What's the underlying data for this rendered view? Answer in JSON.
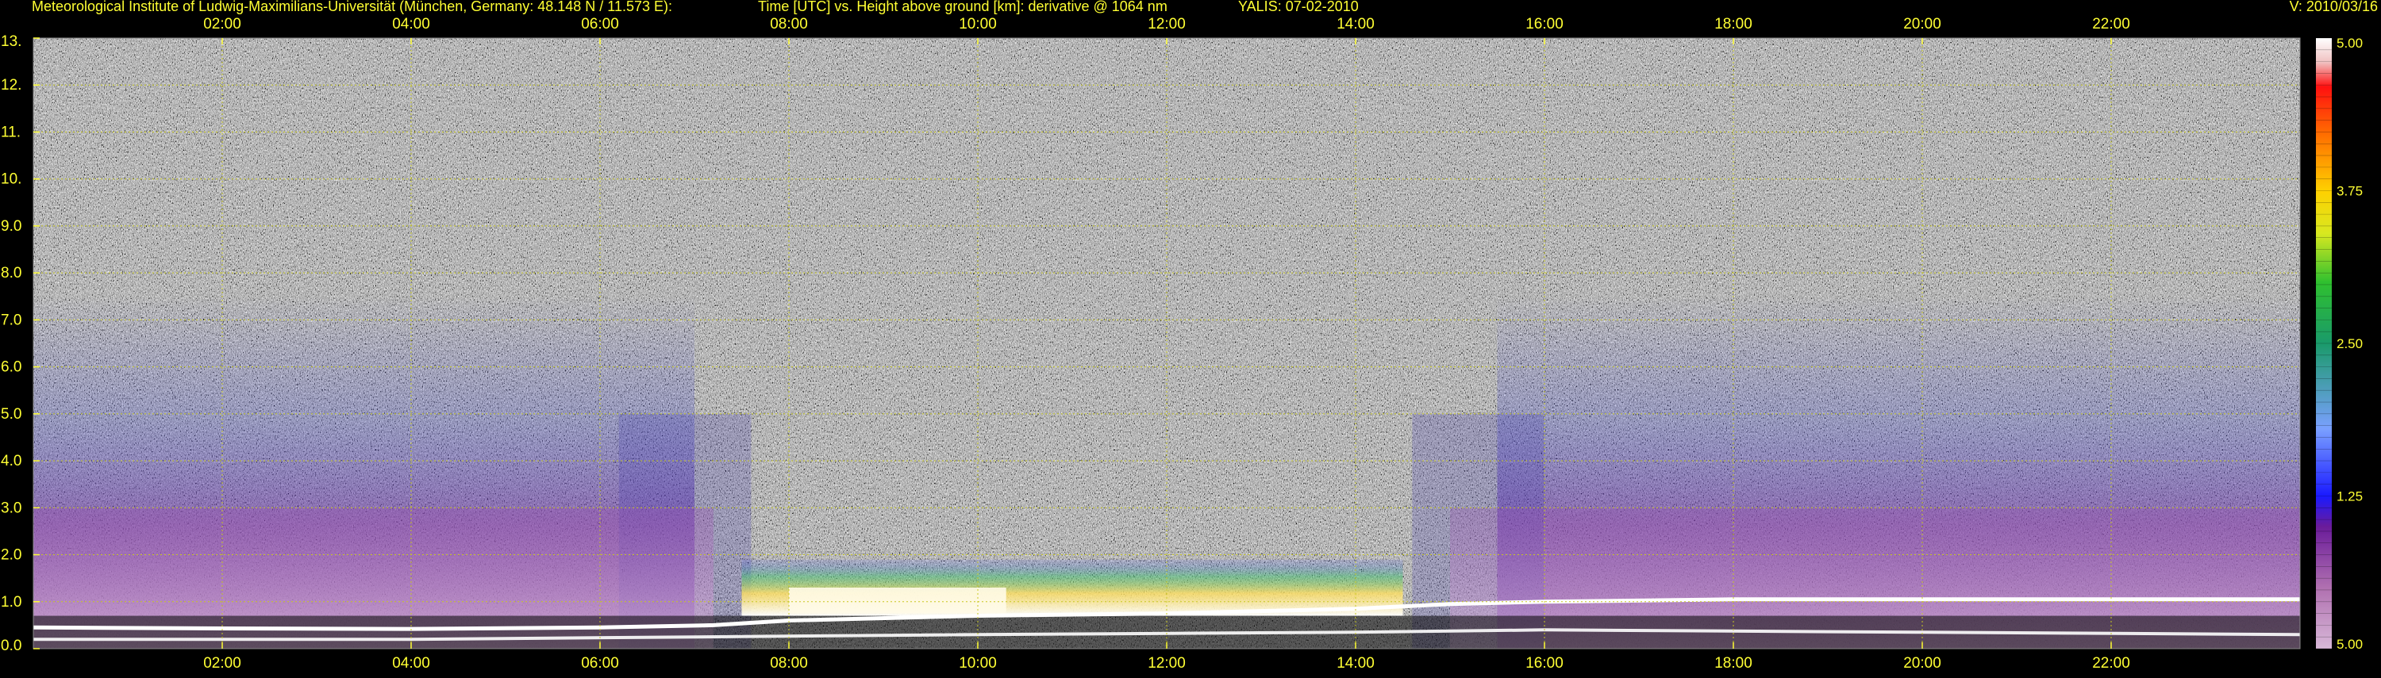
{
  "header": {
    "institute": "Meteorological Institute of Ludwig-Maximilians-Universität (München, Germany: 48.148 N / 11.573 E):",
    "description": "Time [UTC] vs. Height above ground [km]: derivative @ 1064 nm",
    "station": "YALIS: 07-02-2010",
    "version": "V: 2010/03/16"
  },
  "colors": {
    "label": "#ffff33",
    "grid": "#c8c820",
    "background": "#000000"
  },
  "chart_data": {
    "type": "heatmap",
    "title": "Time [UTC] vs. Height above ground [km]: derivative @ 1064 nm",
    "xlabel": "",
    "ylabel": "",
    "x_unit": "hours UTC",
    "x_range": [
      0,
      24
    ],
    "x_ticks": [
      2,
      4,
      6,
      8,
      10,
      12,
      14,
      16,
      18,
      20,
      22
    ],
    "x_tick_labels": [
      "02:00",
      "04:00",
      "06:00",
      "08:00",
      "10:00",
      "12:00",
      "14:00",
      "16:00",
      "18:00",
      "20:00",
      "22:00"
    ],
    "ylim": [
      0,
      13
    ],
    "y_ticks": [
      0,
      1,
      2,
      3,
      4,
      5,
      6,
      7,
      8,
      9,
      10,
      11,
      12,
      13
    ],
    "y_tick_labels": [
      "0.0",
      "1.0",
      "2.0",
      "3.0",
      "4.0",
      "5.0",
      "6.0",
      "7.0",
      "8.0",
      "9.0",
      "10.",
      "11.",
      "12.",
      "13."
    ],
    "grid": true,
    "colorbar": {
      "labels": [
        "5.00",
        "3.75",
        "2.50",
        "1.25",
        "5.00"
      ],
      "stops": [
        {
          "value": 0.0,
          "color": "#d8b8d8"
        },
        {
          "value": 0.5,
          "color": "#b070b0"
        },
        {
          "value": 1.0,
          "color": "#6a1b9a"
        },
        {
          "value": 1.25,
          "color": "#1a1aff"
        },
        {
          "value": 1.8,
          "color": "#7aa0ff"
        },
        {
          "value": 2.5,
          "color": "#1a9a6a"
        },
        {
          "value": 3.0,
          "color": "#2fc02f"
        },
        {
          "value": 3.4,
          "color": "#d8e820"
        },
        {
          "value": 3.75,
          "color": "#ffd000"
        },
        {
          "value": 4.2,
          "color": "#ff7000"
        },
        {
          "value": 4.6,
          "color": "#ff1010"
        },
        {
          "value": 4.8,
          "color": "#f0c0c0"
        },
        {
          "value": 5.0,
          "color": "#ffffff"
        }
      ]
    },
    "boundary_layer_top": [
      {
        "x": 0.0,
        "y": 0.45
      },
      {
        "x": 2.0,
        "y": 0.43
      },
      {
        "x": 4.0,
        "y": 0.42
      },
      {
        "x": 6.0,
        "y": 0.45
      },
      {
        "x": 7.2,
        "y": 0.5
      },
      {
        "x": 8.0,
        "y": 0.6
      },
      {
        "x": 10.0,
        "y": 0.7
      },
      {
        "x": 12.0,
        "y": 0.75
      },
      {
        "x": 13.0,
        "y": 0.8
      },
      {
        "x": 14.0,
        "y": 0.85
      },
      {
        "x": 15.0,
        "y": 0.95
      },
      {
        "x": 16.0,
        "y": 1.0
      },
      {
        "x": 18.0,
        "y": 1.05
      },
      {
        "x": 20.0,
        "y": 1.05
      },
      {
        "x": 22.0,
        "y": 1.05
      },
      {
        "x": 24.0,
        "y": 1.05
      }
    ],
    "surface_layer": [
      {
        "x": 0.0,
        "y": 0.2
      },
      {
        "x": 4.0,
        "y": 0.2
      },
      {
        "x": 7.0,
        "y": 0.25
      },
      {
        "x": 10.0,
        "y": 0.3
      },
      {
        "x": 14.0,
        "y": 0.35
      },
      {
        "x": 16.0,
        "y": 0.4
      },
      {
        "x": 20.0,
        "y": 0.35
      },
      {
        "x": 24.0,
        "y": 0.3
      }
    ]
  }
}
